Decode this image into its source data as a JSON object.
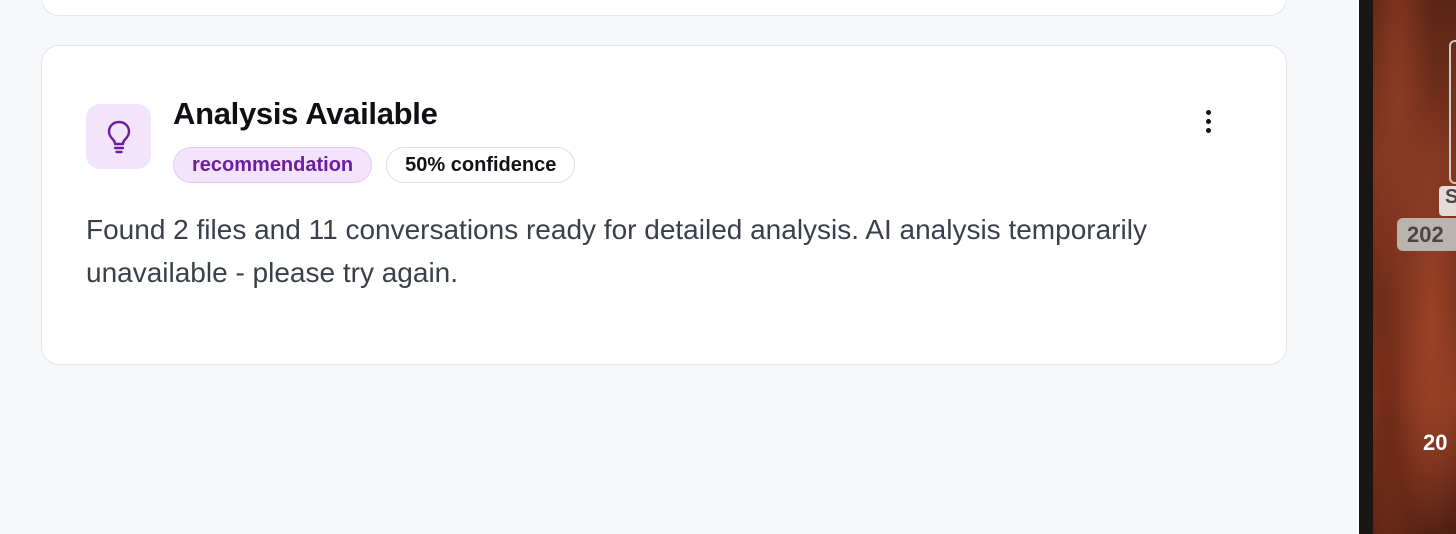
{
  "insight_card": {
    "icon": "lightbulb-icon",
    "title": "Analysis Available",
    "type_badge": "recommendation",
    "confidence_badge": "50% confidence",
    "description": "Found 2 files and 11 conversations ready for detailed analysis. AI analysis temporarily unavailable - please try again.",
    "menu_icon": "more-vertical-icon"
  },
  "wallpaper": {
    "chip_top_text": "S",
    "chip_text": "202",
    "label_text": "20"
  },
  "colors": {
    "accent_purple": "#6b1fa0",
    "badge_purple_bg": "#f3e3fb",
    "page_bg": "#f7f8fa",
    "card_bg": "#ffffff",
    "text_body": "#3a3f4b"
  }
}
